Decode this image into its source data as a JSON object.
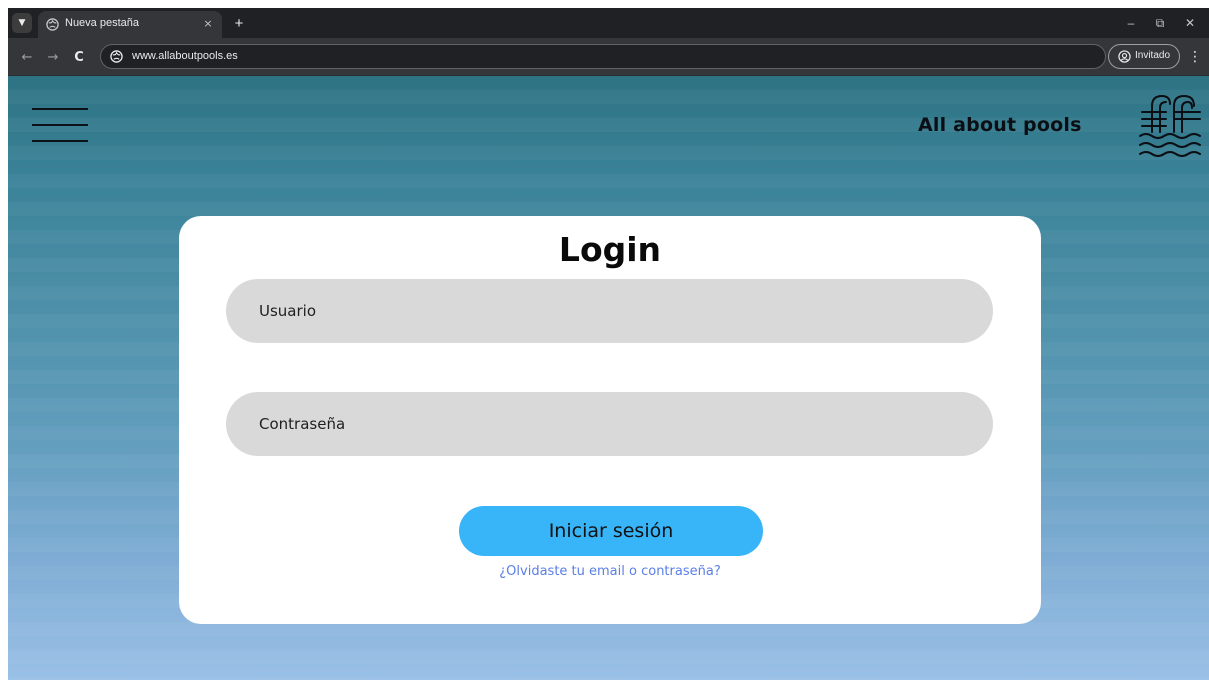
{
  "browser": {
    "tab": {
      "title": "Nueva pestaña",
      "icon": "globe-icon",
      "close": "×"
    },
    "tab_search_icon": "chevron-down-icon",
    "new_tab": "+",
    "window_controls": {
      "minimize": "–",
      "restore": "⧉",
      "close": "✕"
    },
    "nav": {
      "back": "←",
      "forward": "→",
      "reload": "C"
    },
    "url": "www.allaboutpools.es",
    "profile": {
      "label": "Invitado",
      "icon": "guest-profile-icon"
    },
    "menu": "⋮"
  },
  "site": {
    "brand": "All about pools",
    "menu_icon": "hamburger-menu-icon",
    "logo_icon": "pool-ladder-waves-logo",
    "colors": {
      "background_top": "#2e7384",
      "background_bottom": "#9ac0e6",
      "card": "#ffffff",
      "field": "#d9d9d9",
      "button": "#38b4f8",
      "link": "#5a7fe6"
    }
  },
  "login": {
    "title": "Login",
    "username_placeholder": "Usuario",
    "password_placeholder": "Contraseña",
    "submit_label": "Iniciar sesión",
    "forgot_link": "¿Olvidaste tu email o contraseña?"
  }
}
